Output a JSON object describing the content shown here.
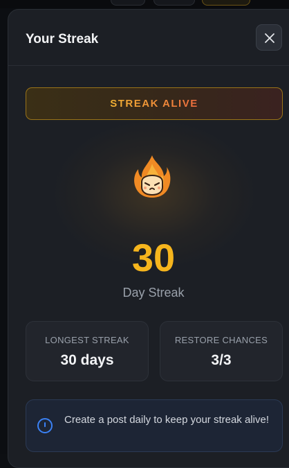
{
  "dialog": {
    "title": "Your Streak",
    "close_icon": "close-icon"
  },
  "status": {
    "label": "STREAK ALIVE",
    "colors": [
      "#f2b233",
      "#ec6a3e"
    ]
  },
  "streak": {
    "icon": "flame-icon",
    "count": "30",
    "label": "Day Streak",
    "color": "#f6b51d"
  },
  "stats": [
    {
      "label": "LONGEST STREAK",
      "value": "30 days"
    },
    {
      "label": "RESTORE CHANCES",
      "value": "3/3"
    }
  ],
  "tip": {
    "icon": "info-icon",
    "text": "Create a post daily to keep your streak alive!"
  }
}
